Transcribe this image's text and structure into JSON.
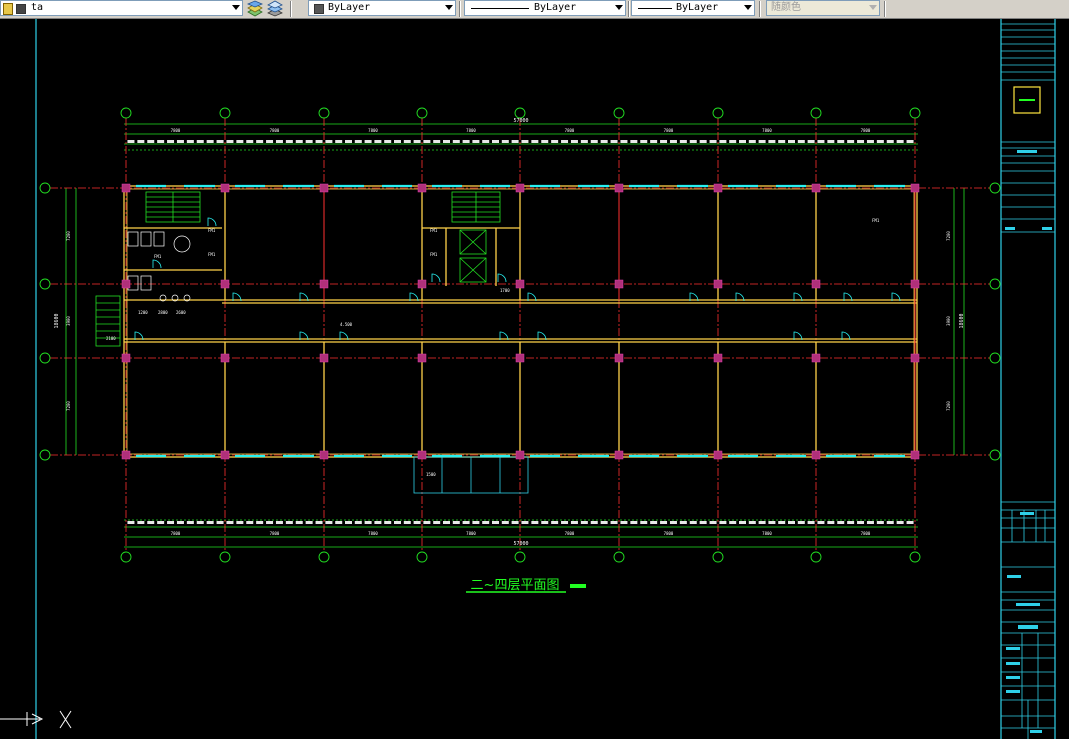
{
  "toolbar": {
    "layer_name": "ta",
    "color_value": "ByLayer",
    "linetype_value": "ByLayer",
    "lineweight_value": "ByLayer",
    "plotstyle_value": "随颜色"
  },
  "drawing": {
    "title": "二~四层平面图",
    "overall_dimension": "57000",
    "bay_labels": [
      "7800",
      "7800",
      "7800",
      "7800",
      "7800",
      "7800",
      "7800",
      "7800"
    ],
    "side_labels": [
      "7200",
      "3900",
      "7200"
    ],
    "side_total": "18600",
    "room_tags": [
      "FM1",
      "FM1",
      "FM1",
      "FM1",
      "FM1",
      "FM1"
    ],
    "stair_label": "4.500",
    "small_dims": [
      "2100",
      "1200",
      "2800",
      "2600",
      "1500",
      "1700"
    ]
  },
  "colors": {
    "canvas": "#000000",
    "axis_line": "#ff3030",
    "wall": "#ffd24a",
    "column": "#b0307a",
    "dimension": "#22e022",
    "window": "#27f0f0",
    "title_block": "#2fd0e8",
    "title_text": "#22ff22"
  }
}
